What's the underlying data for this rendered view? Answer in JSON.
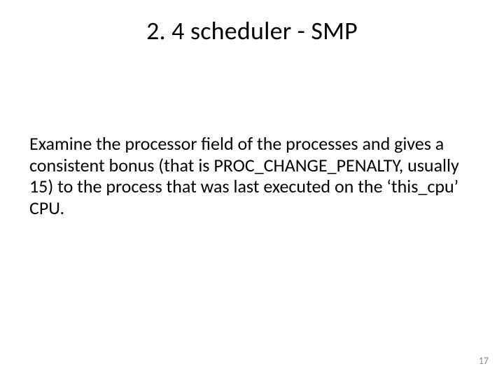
{
  "slide": {
    "title": "2. 4 scheduler - SMP",
    "body": "Examine the processor field of the processes and gives a consistent bonus (that is PROC_CHANGE_PENALTY, usually 15) to the process that was last executed on the ‘this_cpu’ CPU.",
    "page_number": "17"
  }
}
